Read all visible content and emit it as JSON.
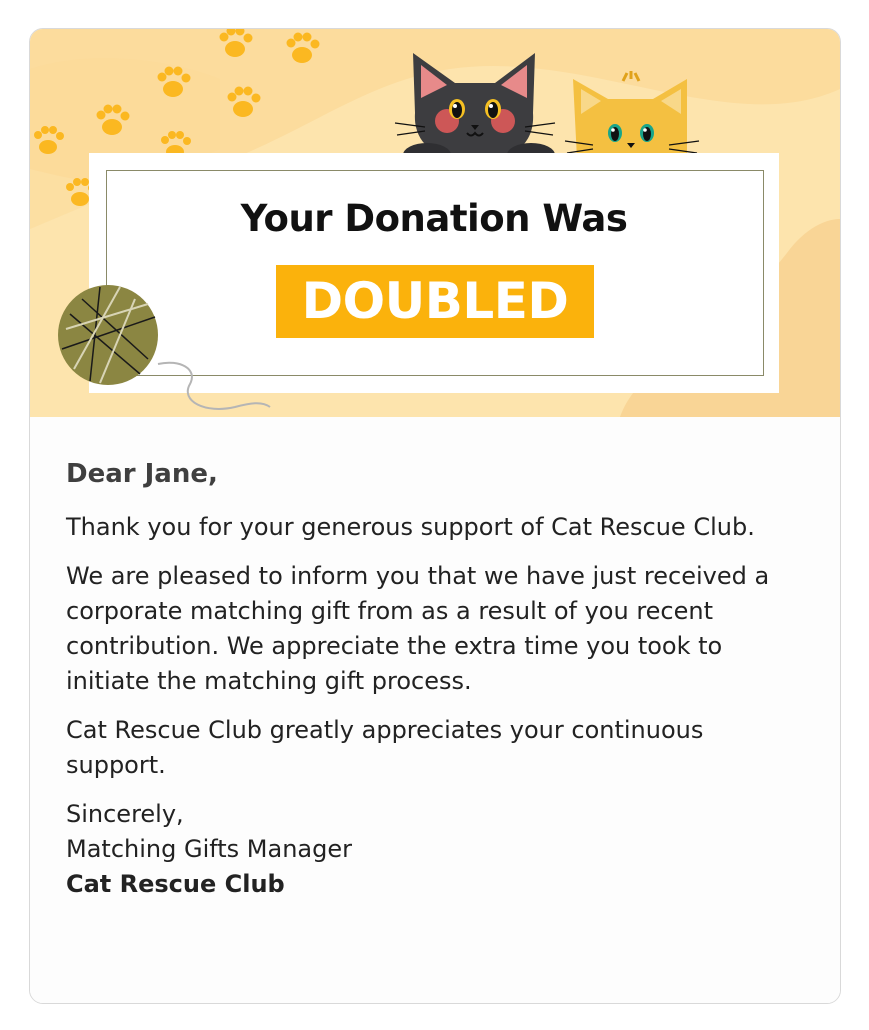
{
  "banner": {
    "headline": "Your Donation Was",
    "highlight": "DOUBLED",
    "colors": {
      "background": "#fde4ad",
      "paw": "#fbb20c",
      "highlight": "#fbb20c"
    }
  },
  "letter": {
    "greeting": "Dear Jane,",
    "paragraphs": [
      "Thank you for your generous support of Cat Rescue Club.",
      "We are pleased to inform you that we have just received a corporate matching gift from as a result of you recent contribution. We appreciate the extra time you took to initiate the matching gift process.",
      "Cat Rescue Club greatly appreciates your continuous support."
    ],
    "closing": "Sincerely,",
    "sender_title": "Matching Gifts Manager",
    "organization": "Cat Rescue Club"
  }
}
